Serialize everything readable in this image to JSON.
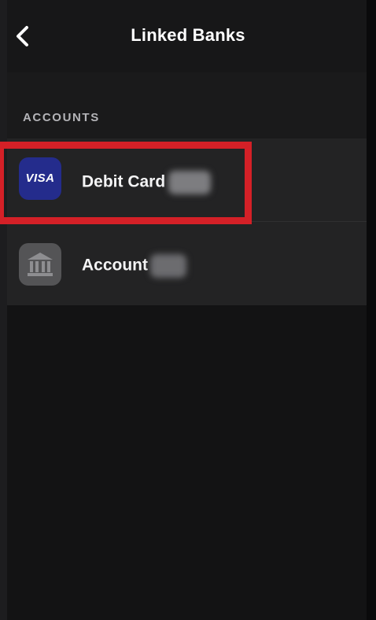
{
  "header": {
    "title": "Linked Banks",
    "back_icon": "chevron-left-icon"
  },
  "accounts_section": {
    "header": "ACCOUNTS",
    "items": [
      {
        "label": "Debit Card",
        "icon": "visa-card-icon",
        "icon_text": "VISA",
        "icon_color": "#242c8c",
        "detail_redacted": true
      },
      {
        "label": "Account",
        "icon": "bank-building-icon",
        "icon_color": "#545456",
        "detail_redacted": true
      }
    ]
  },
  "annotation": {
    "highlight_color": "#d42027",
    "highlighted_item": "Debit Card"
  }
}
